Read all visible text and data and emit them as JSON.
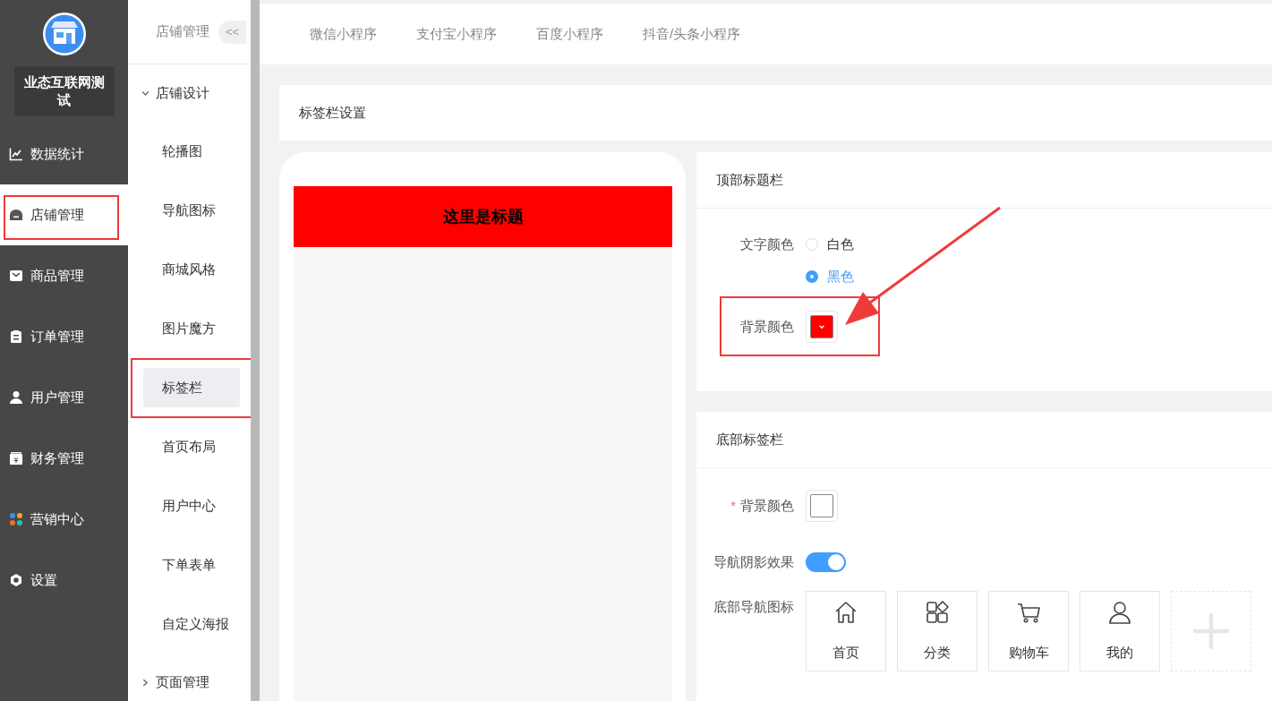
{
  "brand": {
    "name": "业态互联网测试"
  },
  "main_menu": [
    {
      "label": "数据统计",
      "kind": "chart",
      "selected": false,
      "annotated": false
    },
    {
      "label": "店铺管理",
      "kind": "store",
      "selected": true,
      "annotated": true
    },
    {
      "label": "商品管理",
      "kind": "bag",
      "selected": false,
      "annotated": false
    },
    {
      "label": "订单管理",
      "kind": "clipboard",
      "selected": false,
      "annotated": false
    },
    {
      "label": "用户管理",
      "kind": "user",
      "selected": false,
      "annotated": false
    },
    {
      "label": "财务管理",
      "kind": "wallet",
      "selected": false,
      "annotated": false
    },
    {
      "label": "营销中心",
      "kind": "marketing",
      "selected": false,
      "annotated": false
    },
    {
      "label": "设置",
      "kind": "gear",
      "selected": false,
      "annotated": false
    }
  ],
  "sub_menu": {
    "title": "店铺管理",
    "collapse": "<<",
    "groups": [
      {
        "label": "店铺设计",
        "expanded": true,
        "children": [
          {
            "label": "轮播图",
            "selected": false,
            "annotated": false
          },
          {
            "label": "导航图标",
            "selected": false,
            "annotated": false
          },
          {
            "label": "商城风格",
            "selected": false,
            "annotated": false
          },
          {
            "label": "图片魔方",
            "selected": false,
            "annotated": false
          },
          {
            "label": "标签栏",
            "selected": true,
            "annotated": true
          },
          {
            "label": "首页布局",
            "selected": false,
            "annotated": false
          },
          {
            "label": "用户中心",
            "selected": false,
            "annotated": false
          },
          {
            "label": "下单表单",
            "selected": false,
            "annotated": false
          },
          {
            "label": "自定义海报",
            "selected": false,
            "annotated": false
          }
        ]
      },
      {
        "label": "页面管理",
        "expanded": false
      }
    ]
  },
  "platform_tabs": [
    "微信小程序",
    "支付宝小程序",
    "百度小程序",
    "抖音/头条小程序"
  ],
  "page_title": "标签栏设置",
  "preview": {
    "title": "这里是标题"
  },
  "top_bar": {
    "title": "顶部标题栏",
    "text_color": {
      "label": "文字颜色",
      "options": [
        {
          "label": "白色",
          "selected": false
        },
        {
          "label": "黑色",
          "selected": true
        }
      ]
    },
    "background": {
      "label": "背景颜色",
      "color": "#ff0000",
      "annotated": true
    }
  },
  "bottom_bar": {
    "title": "底部标签栏",
    "background": {
      "required_mark": "*",
      "label": "背景颜色",
      "color": "#ffffff"
    },
    "shadow": {
      "label": "导航阴影效果",
      "on": true
    },
    "nav_icons": {
      "label": "底部导航图标",
      "items": [
        {
          "label": "首页",
          "kind": "home"
        },
        {
          "label": "分类",
          "kind": "category"
        },
        {
          "label": "购物车",
          "kind": "cart"
        },
        {
          "label": "我的",
          "kind": "user"
        }
      ]
    }
  },
  "arrow_annotation": true
}
